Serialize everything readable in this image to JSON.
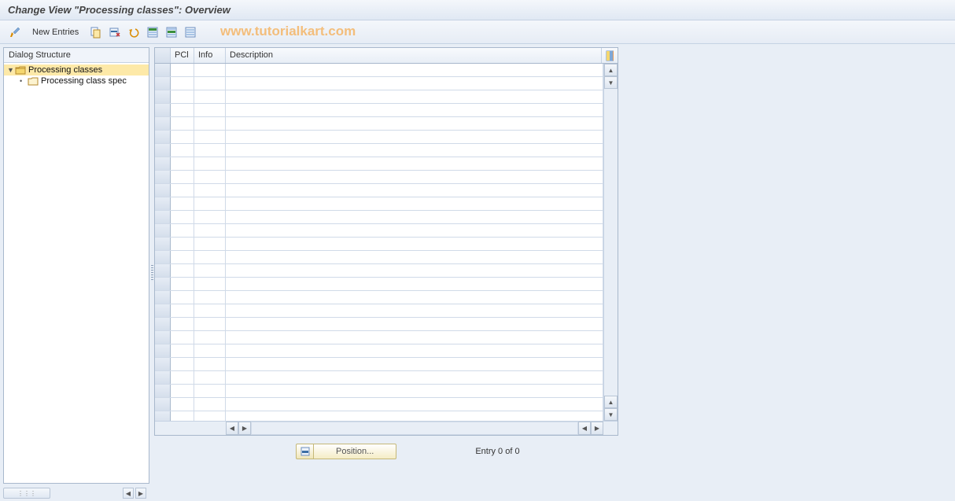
{
  "title": "Change View \"Processing classes\": Overview",
  "watermark": "www.tutorialkart.com",
  "toolbar": {
    "new_entries_label": "New Entries"
  },
  "sidebar": {
    "header": "Dialog Structure",
    "items": [
      {
        "label": "Processing classes",
        "selected": true,
        "expanded": true
      },
      {
        "label": "Processing class spec",
        "selected": false,
        "child": true
      }
    ]
  },
  "table": {
    "columns": {
      "pcl": "PCl",
      "info": "Info",
      "description": "Description"
    },
    "rows": [],
    "empty_row_count": 28
  },
  "footer": {
    "position_label": "Position...",
    "entry_text": "Entry 0 of 0"
  },
  "icons": {
    "toggle": "toggle-icon",
    "copy": "copy-icon",
    "save_variant": "save-variant-icon",
    "undo": "undo-icon",
    "select_all": "select-all-icon",
    "sel_block": "select-block-icon",
    "deselect": "deselect-all-icon",
    "table_settings": "table-settings-icon"
  }
}
